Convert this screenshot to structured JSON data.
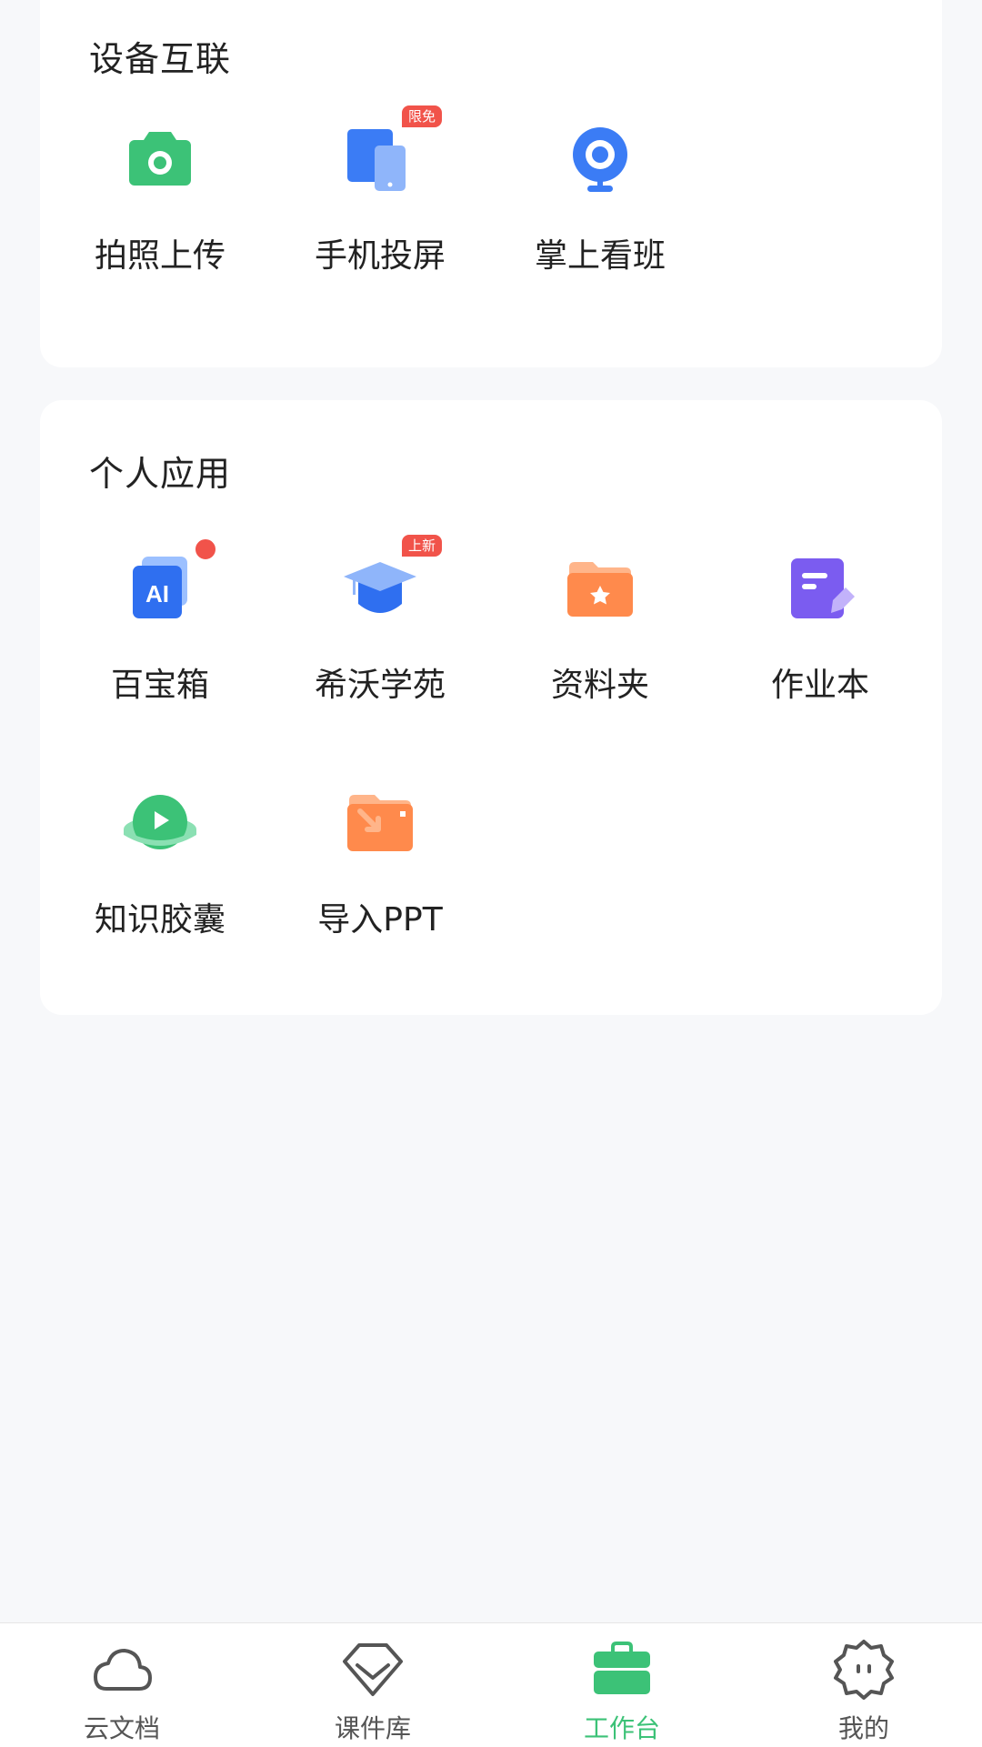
{
  "device_section": {
    "title": "设备互联",
    "apps": [
      {
        "label": "拍照上传",
        "icon": "camera-icon",
        "badge": ""
      },
      {
        "label": "手机投屏",
        "icon": "screen-cast-icon",
        "badge": "限免"
      },
      {
        "label": "掌上看班",
        "icon": "webcam-icon",
        "badge": ""
      }
    ]
  },
  "personal_section": {
    "title": "个人应用",
    "apps": [
      {
        "label": "百宝箱",
        "icon": "ai-toolbox-icon",
        "badge": "",
        "dot": true
      },
      {
        "label": "希沃学苑",
        "icon": "graduation-cap-icon",
        "badge": "上新"
      },
      {
        "label": "资料夹",
        "icon": "star-folder-icon",
        "badge": ""
      },
      {
        "label": "作业本",
        "icon": "homework-notebook-icon",
        "badge": ""
      },
      {
        "label": "知识胶囊",
        "icon": "knowledge-capsule-icon",
        "badge": ""
      },
      {
        "label": "导入PPT",
        "icon": "import-ppt-icon",
        "badge": ""
      }
    ]
  },
  "tabbar": {
    "items": [
      {
        "label": "云文档",
        "icon": "cloud-icon",
        "active": false
      },
      {
        "label": "课件库",
        "icon": "diamond-icon",
        "active": false
      },
      {
        "label": "工作台",
        "icon": "briefcase-icon",
        "active": true
      },
      {
        "label": "我的",
        "icon": "profile-face-icon",
        "active": false
      }
    ]
  },
  "colors": {
    "accent_green": "#3cc277",
    "badge_red": "#f1534a",
    "blue": "#3b7cf5",
    "orange": "#ff8a4c",
    "purple": "#7b5cf0"
  }
}
